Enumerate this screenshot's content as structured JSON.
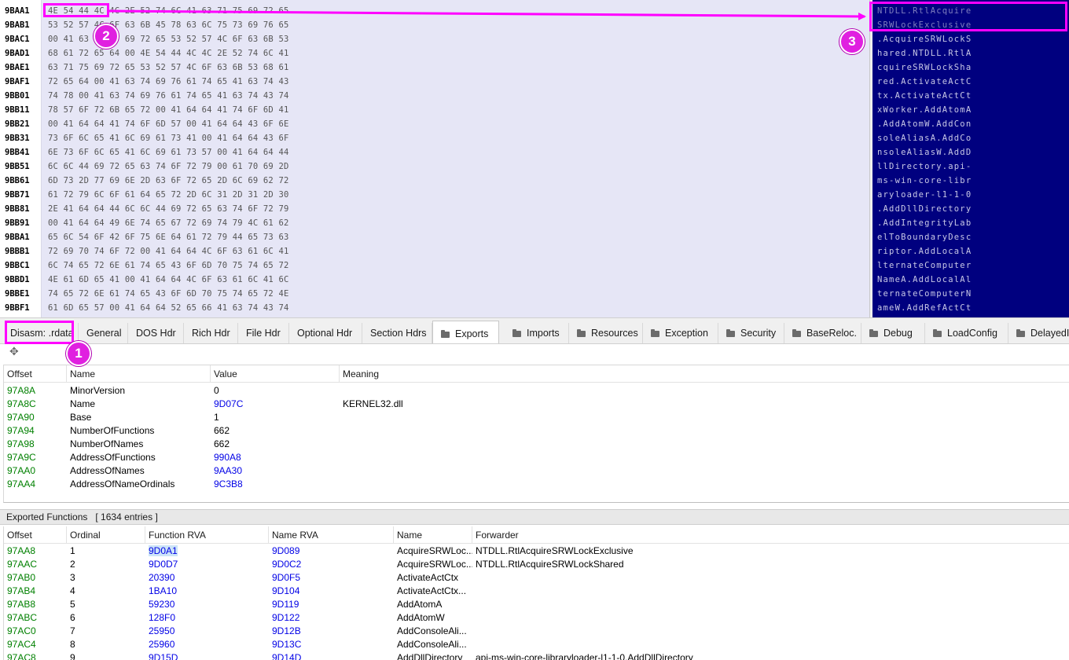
{
  "hex": {
    "rows": [
      {
        "addr": "9BAA1",
        "bytes": "4E 54 44 4C 4C 2E 52 74 6C 41 63 71 75 69 72 65"
      },
      {
        "addr": "9BAB1",
        "bytes": "53 52 57 4C 6F 63 6B 45 78 63 6C 75 73 69 76 65"
      },
      {
        "addr": "9BAC1",
        "bytes": "00 41 63 71 75 69 72 65 53 52 57 4C 6F 63 6B 53"
      },
      {
        "addr": "9BAD1",
        "bytes": "68 61 72 65 64 00 4E 54 44 4C 4C 2E 52 74 6C 41"
      },
      {
        "addr": "9BAE1",
        "bytes": "63 71 75 69 72 65 53 52 57 4C 6F 63 6B 53 68 61"
      },
      {
        "addr": "9BAF1",
        "bytes": "72 65 64 00 41 63 74 69 76 61 74 65 41 63 74 43"
      },
      {
        "addr": "9BB01",
        "bytes": "74 78 00 41 63 74 69 76 61 74 65 41 63 74 43 74"
      },
      {
        "addr": "9BB11",
        "bytes": "78 57 6F 72 6B 65 72 00 41 64 64 41 74 6F 6D 41"
      },
      {
        "addr": "9BB21",
        "bytes": "00 41 64 64 41 74 6F 6D 57 00 41 64 64 43 6F 6E"
      },
      {
        "addr": "9BB31",
        "bytes": "73 6F 6C 65 41 6C 69 61 73 41 00 41 64 64 43 6F"
      },
      {
        "addr": "9BB41",
        "bytes": "6E 73 6F 6C 65 41 6C 69 61 73 57 00 41 64 64 44"
      },
      {
        "addr": "9BB51",
        "bytes": "6C 6C 44 69 72 65 63 74 6F 72 79 00 61 70 69 2D"
      },
      {
        "addr": "9BB61",
        "bytes": "6D 73 2D 77 69 6E 2D 63 6F 72 65 2D 6C 69 62 72"
      },
      {
        "addr": "9BB71",
        "bytes": "61 72 79 6C 6F 61 64 65 72 2D 6C 31 2D 31 2D 30"
      },
      {
        "addr": "9BB81",
        "bytes": "2E 41 64 64 44 6C 6C 44 69 72 65 63 74 6F 72 79"
      },
      {
        "addr": "9BB91",
        "bytes": "00 41 64 64 49 6E 74 65 67 72 69 74 79 4C 61 62"
      },
      {
        "addr": "9BBA1",
        "bytes": "65 6C 54 6F 42 6F 75 6E 64 61 72 79 44 65 73 63"
      },
      {
        "addr": "9BBB1",
        "bytes": "72 69 70 74 6F 72 00 41 64 64 4C 6F 63 61 6C 41"
      },
      {
        "addr": "9BBC1",
        "bytes": "6C 74 65 72 6E 61 74 65 43 6F 6D 70 75 74 65 72"
      },
      {
        "addr": "9BBD1",
        "bytes": "4E 61 6D 65 41 00 41 64 64 4C 6F 63 61 6C 41 6C"
      },
      {
        "addr": "9BBE1",
        "bytes": "74 65 72 6E 61 74 65 43 6F 6D 70 75 74 65 72 4E"
      },
      {
        "addr": "9BBF1",
        "bytes": "61 6D 65 57 00 41 64 64 52 65 66 41 63 74 43 74"
      }
    ]
  },
  "ascii": {
    "rows": [
      "NTDLL.RtlAcquire",
      "SRWLockExclusive",
      ".AcquireSRWLockS",
      "hared.NTDLL.RtlA",
      "cquireSRWLockSha",
      "red.ActivateActC",
      "tx.ActivateActCt",
      "xWorker.AddAtomA",
      ".AddAtomW.AddCon",
      "soleAliasA.AddCo",
      "nsoleAliasW.AddD",
      "llDirectory.api-",
      "ms-win-core-libr",
      "aryloader-l1-1-0",
      ".AddDllDirectory",
      ".AddIntegrityLab",
      "elToBoundaryDesc",
      "riptor.AddLocalA",
      "lternateComputer",
      "NameA.AddLocalAl",
      "ternateComputerN",
      "ameW.AddRefActCt"
    ]
  },
  "tabs": [
    {
      "label": "Disasm: .rdata",
      "folder": false,
      "active": false
    },
    {
      "label": "General",
      "folder": false,
      "active": false
    },
    {
      "label": "DOS Hdr",
      "folder": false,
      "active": false
    },
    {
      "label": "Rich Hdr",
      "folder": false,
      "active": false
    },
    {
      "label": "File Hdr",
      "folder": false,
      "active": false
    },
    {
      "label": "Optional Hdr",
      "folder": false,
      "active": false
    },
    {
      "label": "Section Hdrs",
      "folder": false,
      "active": false
    },
    {
      "label": "Exports",
      "folder": true,
      "active": true
    },
    {
      "label": "Imports",
      "folder": true,
      "active": false
    },
    {
      "label": "Resources",
      "folder": true,
      "active": false
    },
    {
      "label": "Exception",
      "folder": true,
      "active": false
    },
    {
      "label": "Security",
      "folder": true,
      "active": false
    },
    {
      "label": "BaseReloc.",
      "folder": true,
      "active": false
    },
    {
      "label": "Debug",
      "folder": true,
      "active": false
    },
    {
      "label": "LoadConfig",
      "folder": true,
      "active": false
    },
    {
      "label": "DelayedI",
      "folder": true,
      "active": false
    }
  ],
  "toolbar": {
    "icon": "move-icon",
    "glyph": "✥"
  },
  "dir_table": {
    "headers": [
      "Offset",
      "Name",
      "Value",
      "Meaning"
    ],
    "rows": [
      {
        "offset": "97A8A",
        "name": "MinorVersion",
        "value": "0",
        "value_link": false,
        "meaning": ""
      },
      {
        "offset": "97A8C",
        "name": "Name",
        "value": "9D07C",
        "value_link": true,
        "meaning": "KERNEL32.dll"
      },
      {
        "offset": "97A90",
        "name": "Base",
        "value": "1",
        "value_link": false,
        "meaning": ""
      },
      {
        "offset": "97A94",
        "name": "NumberOfFunctions",
        "value": "662",
        "value_link": false,
        "meaning": ""
      },
      {
        "offset": "97A98",
        "name": "NumberOfNames",
        "value": "662",
        "value_link": false,
        "meaning": ""
      },
      {
        "offset": "97A9C",
        "name": "AddressOfFunctions",
        "value": "990A8",
        "value_link": true,
        "meaning": ""
      },
      {
        "offset": "97AA0",
        "name": "AddressOfNames",
        "value": "9AA30",
        "value_link": true,
        "meaning": ""
      },
      {
        "offset": "97AA4",
        "name": "AddressOfNameOrdinals",
        "value": "9C3B8",
        "value_link": true,
        "meaning": ""
      }
    ]
  },
  "exports": {
    "title": "Exported Functions   [ 1634 entries ]",
    "headers": [
      "Offset",
      "Ordinal",
      "Function RVA",
      "Name RVA",
      "Name",
      "Forwarder"
    ],
    "rows": [
      {
        "offset": "97AA8",
        "ordinal": "1",
        "func_rva": "9D0A1",
        "name_rva": "9D089",
        "name": "AcquireSRWLoc...",
        "forwarder": "NTDLL.RtlAcquireSRWLockExclusive"
      },
      {
        "offset": "97AAC",
        "ordinal": "2",
        "func_rva": "9D0D7",
        "name_rva": "9D0C2",
        "name": "AcquireSRWLoc...",
        "forwarder": "NTDLL.RtlAcquireSRWLockShared"
      },
      {
        "offset": "97AB0",
        "ordinal": "3",
        "func_rva": "20390",
        "name_rva": "9D0F5",
        "name": "ActivateActCtx",
        "forwarder": ""
      },
      {
        "offset": "97AB4",
        "ordinal": "4",
        "func_rva": "1BA10",
        "name_rva": "9D104",
        "name": "ActivateActCtx...",
        "forwarder": ""
      },
      {
        "offset": "97AB8",
        "ordinal": "5",
        "func_rva": "59230",
        "name_rva": "9D119",
        "name": "AddAtomA",
        "forwarder": ""
      },
      {
        "offset": "97ABC",
        "ordinal": "6",
        "func_rva": "128F0",
        "name_rva": "9D122",
        "name": "AddAtomW",
        "forwarder": ""
      },
      {
        "offset": "97AC0",
        "ordinal": "7",
        "func_rva": "25950",
        "name_rva": "9D12B",
        "name": "AddConsoleAli...",
        "forwarder": ""
      },
      {
        "offset": "97AC4",
        "ordinal": "8",
        "func_rva": "25960",
        "name_rva": "9D13C",
        "name": "AddConsoleAli...",
        "forwarder": ""
      },
      {
        "offset": "97AC8",
        "ordinal": "9",
        "func_rva": "9D15D",
        "name_rva": "9D14D",
        "name": "AddDllDirectory",
        "forwarder": "api-ms-win-core-libraryloader-l1-1-0.AddDllDirectory"
      }
    ]
  },
  "annotations": {
    "color": "#ff00ff",
    "badges": [
      "1",
      "2",
      "3"
    ]
  }
}
